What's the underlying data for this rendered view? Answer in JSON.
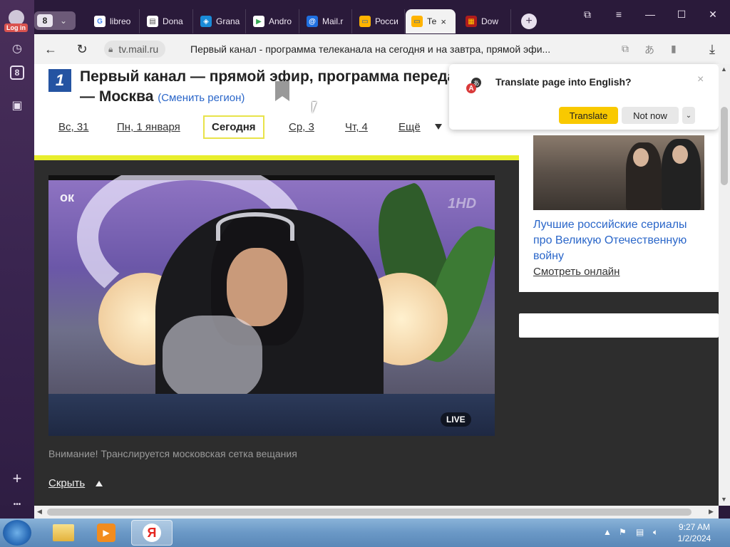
{
  "sidebar": {
    "login_label": "Log in",
    "items": [
      {
        "name": "history-icon",
        "glyph": "◷"
      },
      {
        "name": "eight-icon",
        "glyph": "8"
      },
      {
        "name": "camera-icon",
        "glyph": "▣"
      }
    ],
    "add_glyph": "+",
    "more_glyph": "•••"
  },
  "tabstrip": {
    "counter": "8",
    "tabs": [
      {
        "label": "libreo",
        "icon": "G",
        "icon_color": "#ffffff",
        "icon_fg": "#4285f4"
      },
      {
        "label": "Dona",
        "icon": "▤",
        "icon_color": "#ffffff",
        "icon_fg": "#555555"
      },
      {
        "label": "Grana",
        "icon": "◈",
        "icon_color": "#1a8bd8",
        "icon_fg": "#ffffff"
      },
      {
        "label": "Andro",
        "icon": "▶",
        "icon_color": "#ffffff",
        "icon_fg": "#34a853"
      },
      {
        "label": "Mail.r",
        "icon": "@",
        "icon_color": "#1f6fe0",
        "icon_fg": "#ffffff"
      },
      {
        "label": "Росси",
        "icon": "▭",
        "icon_color": "#ffb300",
        "icon_fg": "#1a5fb4"
      },
      {
        "label": "Те",
        "icon": "▭",
        "icon_color": "#ffb300",
        "icon_fg": "#1a5fb4",
        "active": true
      },
      {
        "label": "Dow",
        "icon": "▦",
        "icon_color": "#b01c1c",
        "icon_fg": "#ffcc00"
      }
    ],
    "new_tab": "+",
    "close": "×"
  },
  "window_controls": {
    "bookmark": "⧉",
    "menu": "≡",
    "minimize": "—",
    "maximize": "☐",
    "close": "✕"
  },
  "addressbar": {
    "back": "←",
    "reload": "↻",
    "domain": "tv.mail.ru",
    "title": "Первый канал - программа телеканала на сегодня и на завтра, прямой эфи...",
    "download": "⤓"
  },
  "page": {
    "logo": "1",
    "title_line1": "Первый канал — прямой эфир, программа передач",
    "title_line2": "— Москва",
    "change_region": "(Сменить регион)",
    "days": [
      "Вс, 31",
      "Пн, 1 января",
      "Сегодня",
      "Ср, 3",
      "Чт, 4",
      "Ещё"
    ],
    "video": {
      "ok_logo": "ок",
      "hd": "1HD",
      "live": "LIVE"
    },
    "notice": "Внимание! Транслируется московская сетка вещания",
    "hide": "Скрыть"
  },
  "aside": {
    "title": "Лучшие российские сериалы про Великую Отечественную войну",
    "link": "Смотреть онлайн"
  },
  "translate": {
    "title": "Translate page into English?",
    "yes": "Translate",
    "no": "Not now",
    "more": "⌄",
    "close": "×"
  },
  "taskbar": {
    "time": "9:27 AM",
    "date": "1/2/2024",
    "yandex_glyph": "Я"
  },
  "colors": {
    "accent_yellow": "#f9c900",
    "link_blue": "#2a66c9",
    "day_highlight": "#e8e34a",
    "channel_blue": "#2554a2"
  }
}
